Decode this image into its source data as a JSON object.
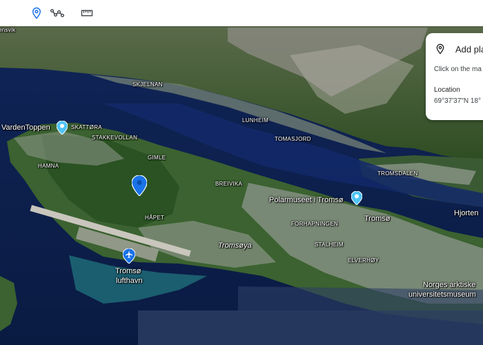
{
  "toolbar": {
    "tools": [
      {
        "name": "add-place",
        "icon": "location-pin-icon",
        "active": true
      },
      {
        "name": "draw-path",
        "icon": "path-polyline-icon",
        "active": false
      },
      {
        "name": "measure",
        "icon": "ruler-icon",
        "active": false
      }
    ]
  },
  "map": {
    "labels": {
      "ensvik": "ensvik",
      "skjelnan": "SKJELNAN",
      "lunheim": "LUNHEIM",
      "tomasjord": "TOMASJORD",
      "tromsdalen": "TROMSDALEN",
      "varden": "VardenToppen",
      "skattora": "SKATTØRA",
      "stakkevollan": "STAKKEVOLLAN",
      "hamna": "HAMNA",
      "gimle": "GIMLE",
      "breivika": "BREIVIKA",
      "polarmuseet": "Polarmuseet i Tromsø",
      "hjorten": "Hjorten",
      "tromso_city": "Tromsø",
      "hapet": "HÅPET",
      "forhapningen": "FORHAPNINGEN",
      "tromsoya": "Tromsøya",
      "stalheim": "STALHEIM",
      "elverhoy": "ELVERHØY",
      "airport_line1": "Tromsø",
      "airport_line2": "lufthavn",
      "museum_line1": "Norges arktiske",
      "museum_line2": "universitetsmuseum"
    },
    "colors": {
      "water": "#0f2456",
      "land": "#2f5a2a",
      "city": "#8f9a8a",
      "pin_selected": "#1a73e8",
      "pin_poi": "#4fc3f7"
    }
  },
  "panel": {
    "title": "Add pla",
    "description": "Click on the ma",
    "location_heading": "Location",
    "coordinates": "69°37'37\"N 18°"
  }
}
